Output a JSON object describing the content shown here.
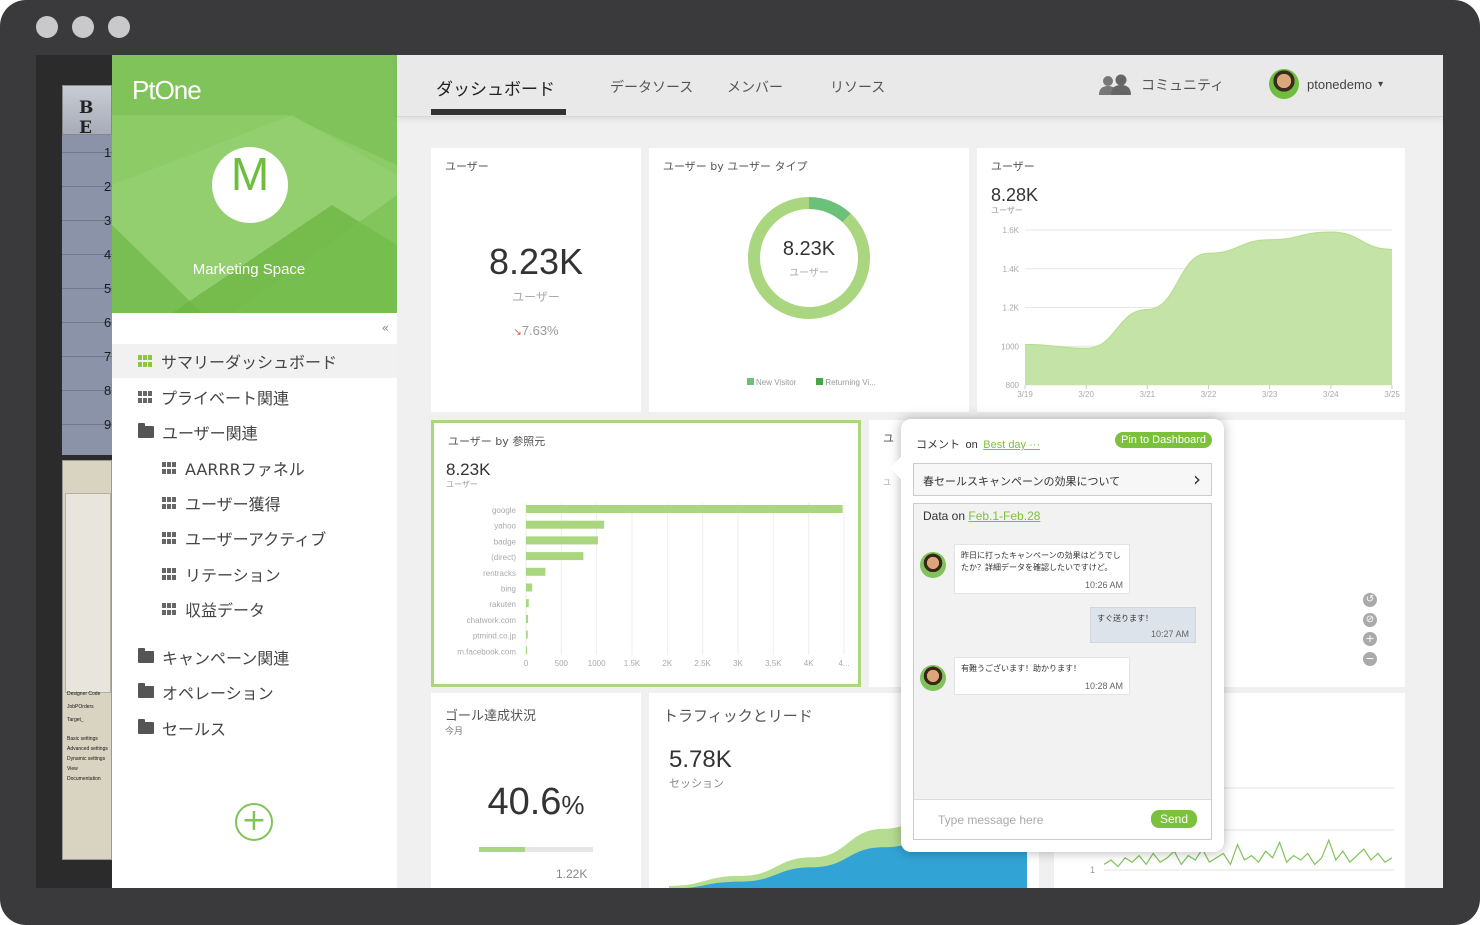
{
  "colors": {
    "accent": "#7fc35a",
    "bar": "#a9d67f",
    "area": "#c4e3a6",
    "blue": "#2b9fd9"
  },
  "bg_app": {
    "toolbar_text": "B E",
    "row_numbers": [
      "1",
      "2",
      "3",
      "4",
      "5",
      "6",
      "7",
      "8",
      "9"
    ],
    "panel_lines": [
      "Designer  Code",
      "JobPOrders",
      "Target_",
      "Basic settings",
      "Advanced settings",
      "Dynamic settings",
      "View",
      "Documentation"
    ]
  },
  "sidebar": {
    "logo": "PtOne",
    "avatar_letter": "M",
    "space_name": "Marketing Space",
    "collapse_icon": "«",
    "items": [
      {
        "label": "サマリーダッシュボード",
        "icon": "grid-icon"
      },
      {
        "label": "プライベート関連",
        "icon": "grid-icon"
      },
      {
        "label": "ユーザー関連",
        "icon": "folder-open-icon"
      },
      {
        "label": "AARRRファネル",
        "icon": "grid-icon"
      },
      {
        "label": "ユーザー獲得",
        "icon": "grid-icon"
      },
      {
        "label": "ユーザーアクティブ",
        "icon": "grid-icon"
      },
      {
        "label": "リテーション",
        "icon": "grid-icon"
      },
      {
        "label": "収益データ",
        "icon": "grid-icon"
      },
      {
        "label": "キャンペーン関連",
        "icon": "folder-icon"
      },
      {
        "label": "オペレーション",
        "icon": "folder-icon"
      },
      {
        "label": "セールス",
        "icon": "folder-icon"
      }
    ],
    "add_icon": "+"
  },
  "topnav": {
    "tabs": [
      "ダッシュボード",
      "データソース",
      "メンバー",
      "リソース"
    ],
    "community": "コミュニティ",
    "username": "ptonedemo",
    "caret": "▾"
  },
  "cards": {
    "users_kpi": {
      "title": "ユーザー",
      "value": "8.23K",
      "unit": "ユーザー",
      "change": "7.63%",
      "change_arrow": "↘"
    },
    "donut": {
      "title": "ユーザー by ユーザー タイプ",
      "value": "8.23K",
      "unit": "ユーザー",
      "legend": [
        "New Visitor",
        "Returning Vi..."
      ]
    },
    "area": {
      "title": "ユーザー",
      "value": "8.28K",
      "unit": "ユーザー"
    },
    "referrer": {
      "title": "ユーザー by 参照元",
      "value": "8.23K",
      "unit": "ユーザー"
    },
    "goal": {
      "title": "ゴール達成状況",
      "period": "今月",
      "value": "40.6",
      "percent": "%",
      "target": "1.22K"
    },
    "traffic": {
      "title": "トラフィックとリード",
      "value": "5.78K",
      "unit": "セッション"
    },
    "hidden_card": {
      "title_prefix": "ユ",
      "unit_prefix": "ユ"
    },
    "zoom_controls": [
      "↺",
      "⊘",
      "+",
      "−"
    ],
    "spark_axis": "1"
  },
  "comment": {
    "label": "コメント",
    "on": "on",
    "dashboard_link": "Best day ···",
    "pin_label": "Pin to Dashboard",
    "topic": "春セールスキャンペーンの効果について",
    "chevron": "›",
    "data_on": "Data on",
    "data_range": "Feb.1-Feb.28",
    "messages": [
      {
        "text": "昨日に打ったキャンペーンの効果はどうでしたか？詳細データを確認したいですけど。",
        "time": "10:26 AM"
      },
      {
        "text": "すぐ送ります！",
        "time": "10:27 AM"
      },
      {
        "text": "有難うございます！助かります！",
        "time": "10:28 AM"
      }
    ],
    "placeholder": "Type message here",
    "send": "Send"
  },
  "chart_data": [
    {
      "type": "pie",
      "title": "ユーザー by ユーザー タイプ",
      "categories": [
        "New Visitor",
        "Returning Vi..."
      ],
      "values": [
        12,
        88
      ]
    },
    {
      "type": "area",
      "title": "ユーザー",
      "x": [
        "3/19",
        "3/20",
        "3/21",
        "3/22",
        "3/23",
        "3/24",
        "3/25"
      ],
      "values": [
        1010,
        990,
        1190,
        1480,
        1550,
        1590,
        1500
      ],
      "yticks": [
        "1.6K",
        "1.4K",
        "1.2K",
        "1000",
        "800"
      ],
      "ylim": [
        800,
        1600
      ]
    },
    {
      "type": "bar",
      "title": "ユーザー by 参照元",
      "categories": [
        "google",
        "yahoo",
        "badge",
        "(direct)",
        "rentracks",
        "bing",
        "rakuten",
        "chatwork.com",
        "ptmind.co.jp",
        "m.facebook.com"
      ],
      "values": [
        4580,
        1130,
        1040,
        830,
        280,
        90,
        40,
        30,
        25,
        15
      ],
      "xticks": [
        "0",
        "500",
        "1000",
        "1.5K",
        "2K",
        "2.5K",
        "3K",
        "3.5K",
        "4K",
        "4..."
      ],
      "xlim": [
        0,
        4600
      ]
    },
    {
      "type": "bar",
      "title": "ゴール達成状況",
      "values": [
        40.6
      ]
    },
    {
      "type": "area",
      "title": "トラフィックとリード",
      "series": [
        {
          "values": [
            5,
            12,
            25,
            45,
            62,
            70
          ]
        },
        {
          "values": [
            3,
            8,
            18,
            32,
            44,
            50
          ]
        }
      ]
    },
    {
      "type": "line",
      "values": [
        3,
        5,
        2,
        6,
        4,
        7,
        3,
        8,
        4,
        6,
        9,
        3,
        7,
        5,
        10,
        4,
        6,
        8,
        3,
        12,
        5,
        7,
        4,
        9,
        6,
        13,
        4,
        7,
        5,
        8,
        3,
        6,
        14,
        5,
        9,
        4,
        7,
        10,
        5,
        8,
        4,
        6
      ]
    }
  ]
}
